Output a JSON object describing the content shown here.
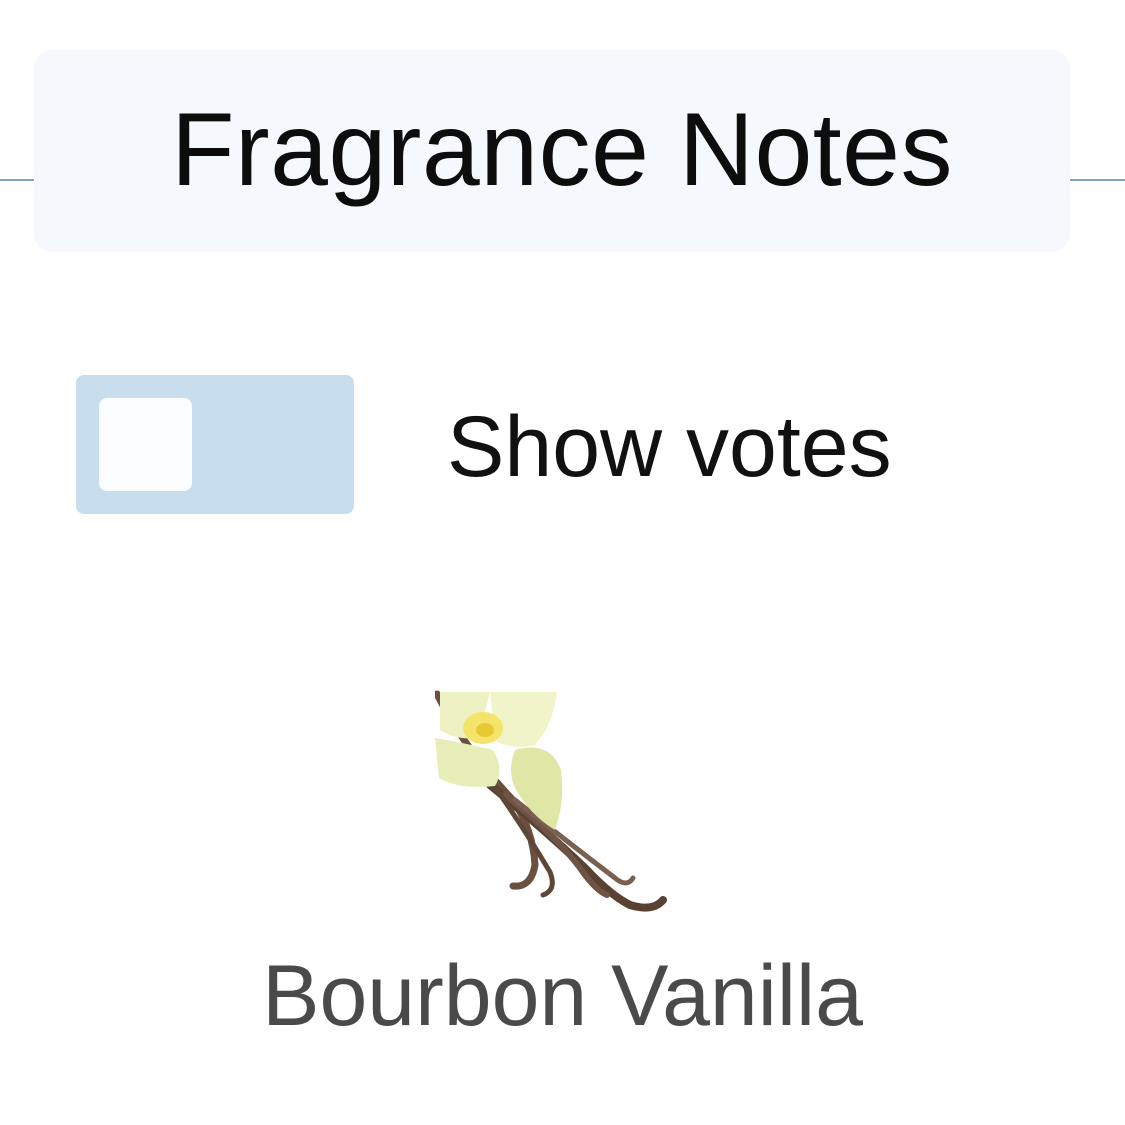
{
  "section": {
    "title": "Fragrance Notes"
  },
  "toggle": {
    "label": "Show votes",
    "checked": false,
    "track_color": "#c8ddee"
  },
  "notes": [
    {
      "name": "Bourbon Vanilla",
      "icon": "vanilla-flower-icon"
    }
  ],
  "colors": {
    "rule": "#7fa3c9",
    "header_background": "#f5f9fd",
    "note_text": "#4a4a4a"
  }
}
